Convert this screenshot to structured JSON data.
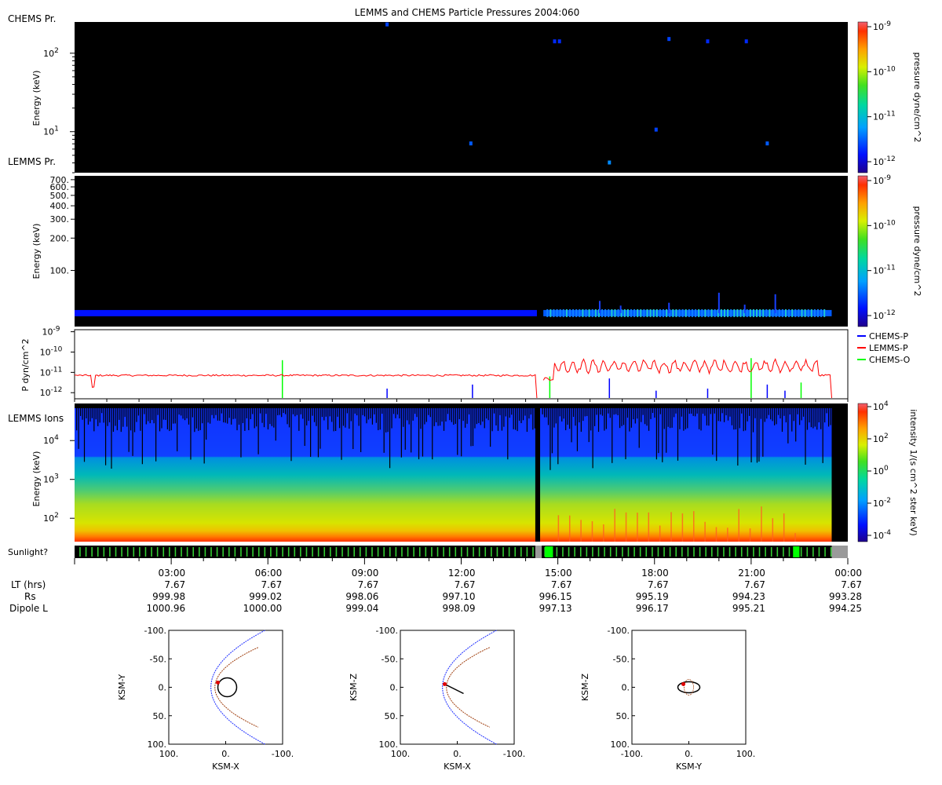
{
  "title": "LEMMS and CHEMS Particle Pressures  2004:060",
  "chart_data": [
    {
      "type": "heatmap",
      "panel_label": "CHEMS Pr.",
      "ylabel": "Energy (keV)",
      "yscale": "log",
      "ylim": [
        3,
        250
      ],
      "ytick_labels": [
        "10^2",
        "10^1"
      ],
      "colorbar": {
        "label": "pressure dyne/cm^2",
        "ticks": [
          "10^-9",
          "10^-10",
          "10^-11",
          "10^-12"
        ]
      },
      "background": "#000000",
      "points": [
        {
          "hour": 9.7,
          "energy": 230,
          "pressure_log": -11.7
        },
        {
          "hour": 14.9,
          "energy": 140,
          "pressure_log": -11.8
        },
        {
          "hour": 15.05,
          "energy": 140,
          "pressure_log": -11.8
        },
        {
          "hour": 18.45,
          "energy": 150,
          "pressure_log": -11.7
        },
        {
          "hour": 19.65,
          "energy": 140,
          "pressure_log": -11.8
        },
        {
          "hour": 20.85,
          "energy": 140,
          "pressure_log": -11.8
        },
        {
          "hour": 12.3,
          "energy": 7,
          "pressure_log": -11.6
        },
        {
          "hour": 18.05,
          "energy": 10.5,
          "pressure_log": -11.7
        },
        {
          "hour": 21.5,
          "energy": 7,
          "pressure_log": -11.6
        },
        {
          "hour": 16.6,
          "energy": 4,
          "pressure_log": -11.4
        }
      ]
    },
    {
      "type": "heatmap",
      "panel_label": "LEMMS Pr.",
      "ylabel": "Energy (keV)",
      "yscale": "log",
      "ylim": [
        30,
        760
      ],
      "ytick_labels": [
        "700.",
        "600.",
        "500.",
        "400.",
        "300.",
        "200.",
        "100."
      ],
      "ytick_values": [
        700,
        600,
        500,
        400,
        300,
        200,
        100
      ],
      "colorbar": {
        "label": "pressure dyne/cm^2",
        "ticks": [
          "10^-9",
          "10^-10",
          "10^-11",
          "10^-12"
        ]
      },
      "band_energy": 40,
      "band_segments": [
        [
          0,
          14.35,
          -11.9
        ],
        [
          14.55,
          23.5,
          -11.6
        ]
      ],
      "spikes": [
        {
          "hour": 16.3,
          "top": 52
        },
        {
          "hour": 16.95,
          "top": 47
        },
        {
          "hour": 18.45,
          "top": 50
        },
        {
          "hour": 20.0,
          "top": 62
        },
        {
          "hour": 20.8,
          "top": 48
        },
        {
          "hour": 21.75,
          "top": 60
        }
      ]
    },
    {
      "type": "line",
      "ylabel": "P dyn/cm^2",
      "yscale": "log",
      "ytick_labels": [
        "10^-9",
        "10^-10",
        "10^-11",
        "10^-12"
      ],
      "ylim_log": [
        -12.3,
        -8.9
      ],
      "legend_position": "right",
      "series": [
        {
          "name": "CHEMS-P",
          "color": "#0000ff",
          "spikes": [
            [
              9.7,
              -11.8
            ],
            [
              12.35,
              -11.6
            ],
            [
              16.6,
              -11.3
            ],
            [
              18.05,
              -11.9
            ],
            [
              19.65,
              -11.8
            ],
            [
              21.5,
              -11.6
            ],
            [
              22.05,
              -11.9
            ]
          ]
        },
        {
          "name": "LEMMS-P",
          "color": "#ff0000",
          "baseline_log": -11.15,
          "active_log": -10.7,
          "segments": [
            [
              0,
              14.35
            ],
            [
              14.55,
              23.5
            ]
          ]
        },
        {
          "name": "CHEMS-O",
          "color": "#00ff00",
          "spikes": [
            [
              6.45,
              -10.4
            ],
            [
              14.75,
              -11.2
            ],
            [
              21.0,
              -10.3
            ],
            [
              22.55,
              -11.5
            ]
          ]
        }
      ]
    },
    {
      "type": "heatmap",
      "panel_label": "LEMMS Ions",
      "ylabel": "Energy (keV)",
      "yscale": "log",
      "ylim": [
        25,
        90000
      ],
      "ytick_labels": [
        "10^4",
        "10^3",
        "10^2"
      ],
      "colorbar": {
        "label": "intensity 1/(s cm^2 ster keV)",
        "ticks": [
          "10^4",
          "10^2",
          "10^0",
          "10^-2",
          "10^-4"
        ]
      },
      "data_end_hour": 23.5,
      "gap_hours": [
        14.3,
        14.45
      ]
    }
  ],
  "sunlight": {
    "label": "Sunlight?",
    "data_end_hour": 23.5,
    "gray_blocks": [
      [
        14.3,
        14.5
      ],
      [
        23.5,
        24
      ]
    ],
    "bright_blocks": [
      [
        14.6,
        14.85
      ],
      [
        22.3,
        22.5
      ]
    ],
    "stripe_colors": {
      "bright": "#00ff00",
      "stripe": "#33cc33",
      "gray": "#9a9a9a"
    }
  },
  "time_axis": {
    "ticks": [
      "03:00",
      "06:00",
      "09:00",
      "12:00",
      "15:00",
      "18:00",
      "21:00",
      "00:00"
    ],
    "tick_hours": [
      3,
      6,
      9,
      12,
      15,
      18,
      21,
      24
    ],
    "rows": [
      {
        "label": "LT (hrs)",
        "values": [
          "7.67",
          "7.67",
          "7.67",
          "7.67",
          "7.67",
          "7.67",
          "7.67",
          "7.67"
        ]
      },
      {
        "label": "Rs",
        "values": [
          "999.98",
          "999.02",
          "998.06",
          "997.10",
          "996.15",
          "995.19",
          "994.23",
          "993.28"
        ]
      },
      {
        "label": "Dipole L",
        "values": [
          "1000.96",
          "1000.00",
          "999.04",
          "998.09",
          "997.13",
          "996.17",
          "995.21",
          "994.25"
        ]
      }
    ]
  },
  "orbit_plots": [
    {
      "xlabel": "KSM-X",
      "ylabel": "KSM-Y",
      "xticks": [
        "100.",
        "0.",
        "-100."
      ],
      "yticks": [
        "-100.",
        "-50.",
        "0.",
        "50.",
        "100."
      ],
      "kind": "xy"
    },
    {
      "xlabel": "KSM-X",
      "ylabel": "KSM-Z",
      "xticks": [
        "100.",
        "0.",
        "-100."
      ],
      "yticks": [
        "-100.",
        "-50.",
        "0.",
        "50.",
        "100."
      ],
      "kind": "xz"
    },
    {
      "xlabel": "KSM-Y",
      "ylabel": "KSM-Z",
      "xticks": [
        "-100.",
        "0.",
        "100."
      ],
      "yticks": [
        "-100.",
        "-50.",
        "0.",
        "50.",
        "100."
      ],
      "kind": "yz"
    }
  ]
}
